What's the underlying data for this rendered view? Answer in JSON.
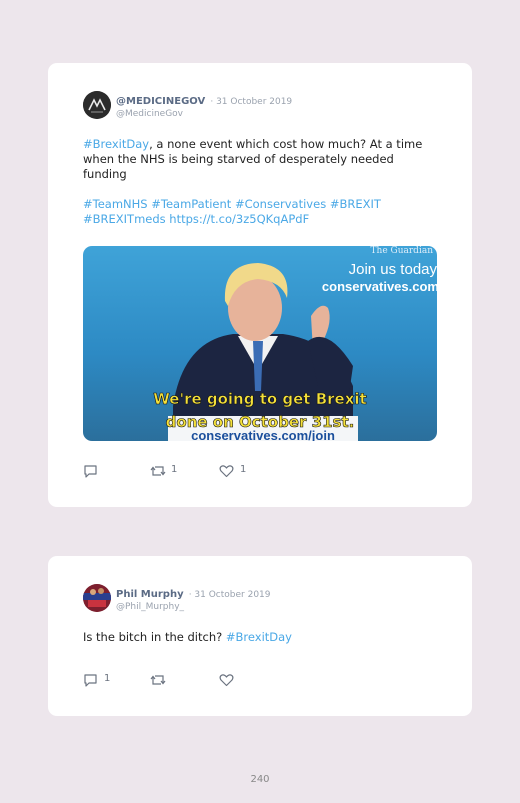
{
  "tweets": [
    {
      "name": "@MEDICINEGOV",
      "date": "· 31 October 2019",
      "handle": "@MedicineGov",
      "text_hashtag1": "#BrexitDay",
      "text_rest": ", a none event which cost how much? At a time when the NHS is being starved of desperately needed funding",
      "tags_line1": "#TeamNHS #TeamPatient #Conservatives #BREXIT",
      "tags_line2": "#BREXITmeds https://t.co/3z5QKqAPdF",
      "media": {
        "brand_top": "The Guardian",
        "join_text": "Join us today",
        "site_text": "conservatives.com",
        "caption_line1": "We're going to get Brexit",
        "caption_line2": "done on October 31st.",
        "podium_text": "conservatives.com/join"
      },
      "reply_count": "",
      "retweet_count": "1",
      "like_count": "1"
    },
    {
      "name": "Phil Murphy",
      "date": "· 31 October 2019",
      "handle": "@Phil_Murphy_",
      "text_plain": "Is the bitch in the ditch? ",
      "text_hashtag": "#BrexitDay",
      "reply_count": "1",
      "retweet_count": "",
      "like_count": ""
    }
  ],
  "page_number": "240"
}
